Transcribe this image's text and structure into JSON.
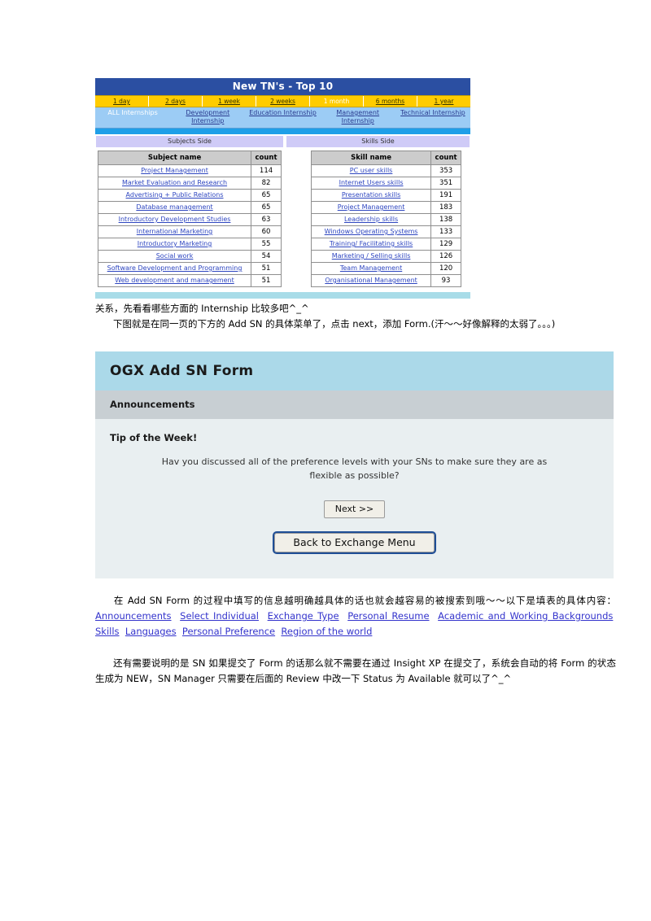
{
  "tn_panel": {
    "title": "New TN's - Top 10",
    "time_filters": [
      {
        "label": "1 day",
        "selected": false
      },
      {
        "label": "2 days",
        "selected": false
      },
      {
        "label": "1 week",
        "selected": false
      },
      {
        "label": "2 weeks",
        "selected": false
      },
      {
        "label": "1 month",
        "selected": true
      },
      {
        "label": "6 months",
        "selected": false
      },
      {
        "label": "1 year",
        "selected": false
      }
    ],
    "categories": [
      {
        "label": "ALL Internships",
        "selected": true
      },
      {
        "label": "Development Internship",
        "selected": false
      },
      {
        "label": "Education Internship",
        "selected": false
      },
      {
        "label": "Management Internship",
        "selected": false
      },
      {
        "label": "Technical Internship",
        "selected": false
      }
    ],
    "subjects_side": {
      "panel_label": "Subjects Side",
      "columns": [
        "Subject name",
        "count"
      ],
      "rows": [
        {
          "name": "Project Management",
          "count": "114"
        },
        {
          "name": "Market Evaluation and Research",
          "count": "82"
        },
        {
          "name": "Advertising + Public Relations",
          "count": "65"
        },
        {
          "name": "Database management",
          "count": "65"
        },
        {
          "name": "Introductory Development Studies",
          "count": "63"
        },
        {
          "name": "International Marketing",
          "count": "60"
        },
        {
          "name": "Introductory Marketing",
          "count": "55"
        },
        {
          "name": "Social work",
          "count": "54"
        },
        {
          "name": "Software Development and Programming",
          "count": "51"
        },
        {
          "name": "Web development and management",
          "count": "51"
        }
      ]
    },
    "skills_side": {
      "panel_label": "Skills Side",
      "columns": [
        "Skill name",
        "count"
      ],
      "rows": [
        {
          "name": "PC user skills",
          "count": "353"
        },
        {
          "name": "Internet Users skills",
          "count": "351"
        },
        {
          "name": "Presentation skills",
          "count": "191"
        },
        {
          "name": "Project Management",
          "count": "183"
        },
        {
          "name": "Leadership skills",
          "count": "138"
        },
        {
          "name": "Windows Operating Systems",
          "count": "133"
        },
        {
          "name": "Training/ Facilitating skills",
          "count": "129"
        },
        {
          "name": "Marketing / Selling skills",
          "count": "126"
        },
        {
          "name": "Team Management",
          "count": "120"
        },
        {
          "name": "Organisational Management",
          "count": "93"
        }
      ]
    }
  },
  "paragraph_top": {
    "line1": "关系，先看看哪些方面的 Internship 比较多吧^_^",
    "line2": "下图就是在同一页的下方的 Add SN 的具体菜单了，点击 next，添加 Form.(汗～～好像解释的太弱了。。。)"
  },
  "ogx_form": {
    "title": "OGX Add SN Form",
    "section_label": "Announcements",
    "tip_heading": "Tip of the Week!",
    "tip_text": "Hav you discussed all of the preference levels with your SNs to make sure they are as flexible as possible?",
    "next_button": "Next >>",
    "back_button": "Back to Exchange Menu"
  },
  "paragraph_mid": {
    "text_before": "在 Add  SN  Form  的过程中填写的信息越明确越具体的话也就会越容易的被搜索到哦～～以下是填表的具体内容：",
    "links": [
      "Announcements",
      "Select  Individual",
      "Exchange  Type",
      "Personal Resume",
      "Academic and Working Backgrounds",
      "Skills",
      "Languages",
      "Personal Preference",
      "Region of the world"
    ]
  },
  "paragraph_bottom": {
    "text": "还有需要说明的是 SN 如果提交了 Form 的话那么就不需要在通过 Insight XP 在提交了，系统会自动的将 Form 的状态生成为 NEW，SN  Manager 只需要在后面的 Review 中改一下 Status 为 Available 就可以了^_^"
  },
  "colors": {
    "tn_header_blue": "#2B4FA2",
    "time_gold": "#FFCC00",
    "category_blue": "#9CCCF5",
    "divider_blue": "#1F9FE8",
    "side_lavender": "#CFCBF7",
    "table_header_gray": "#CCCCCC",
    "link_blue": "#2E46C0",
    "ogx_title_blue": "#ABD9E9",
    "ogx_sub_gray": "#C8CFD3",
    "ogx_body": "#E9EFF1",
    "doc_link": "#3333CC"
  }
}
